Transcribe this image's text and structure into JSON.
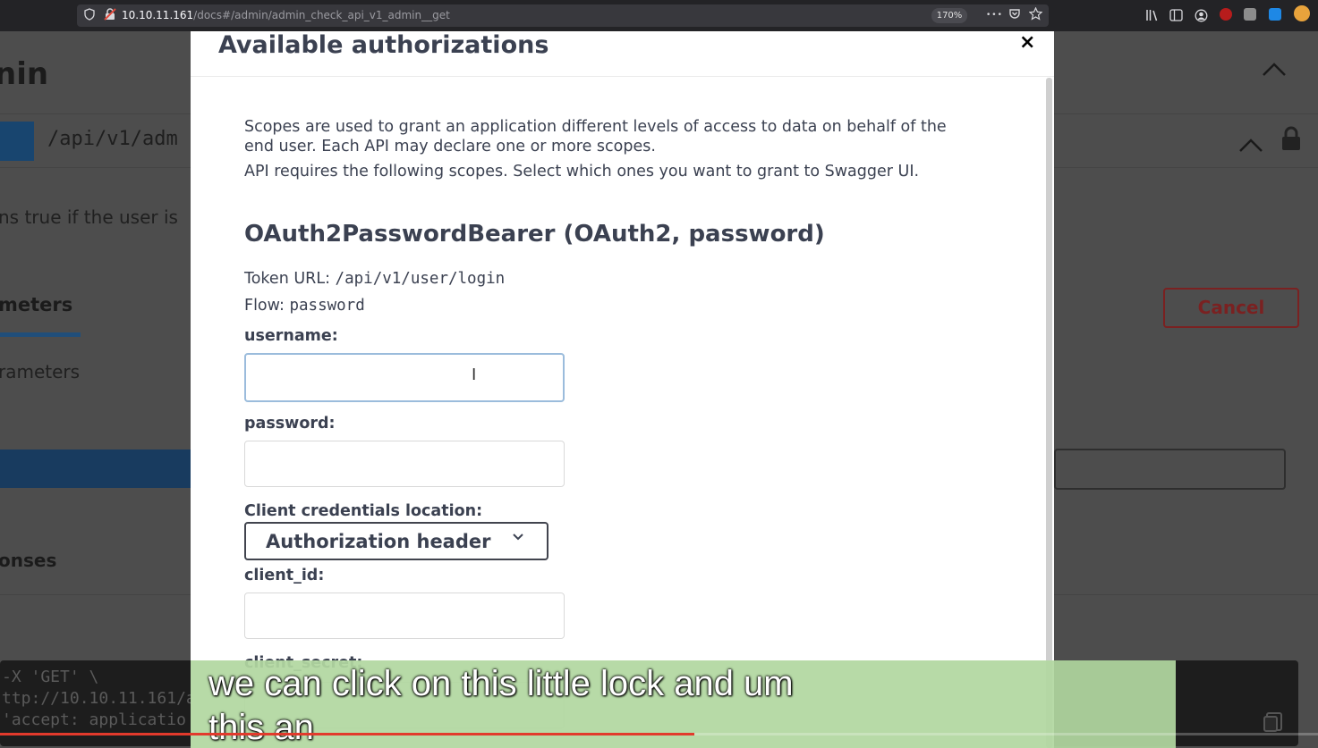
{
  "browser": {
    "url_host": "10.10.11.161",
    "url_path": "/docs#/admin/admin_check_api_v1_admin__get",
    "zoom": "170%",
    "menu_label": "•••"
  },
  "background": {
    "section_title": "nin",
    "endpoint_path": "/api/v1/adm",
    "description": "ns true if the user is",
    "tab_parameters": "meters",
    "no_parameters": "rameters",
    "responses_heading": "onses",
    "cancel_label": "Cancel",
    "curl_lines": [
      "-X 'GET' \\",
      "ttp://10.10.11.161/a",
      "'accept: applicatio"
    ]
  },
  "modal": {
    "title": "Available authorizations",
    "close_glyph": "×",
    "scopes_line1": "Scopes are used to grant an application different levels of access to data on behalf of the",
    "scopes_line2": "end user. Each API may declare one or more scopes.",
    "scopes_line3": "API requires the following scopes. Select which ones you want to grant to Swagger UI.",
    "scheme_title": "OAuth2PasswordBearer (OAuth2, password)",
    "token_url_label": "Token URL:",
    "token_url_value": "/api/v1/user/login",
    "flow_label": "Flow:",
    "flow_value": "password",
    "username_label": "username:",
    "password_label": "password:",
    "client_location_label": "Client credentials location:",
    "client_location_value": "Authorization header",
    "client_id_label": "client_id:",
    "client_secret_label": "client_secret:"
  },
  "subtitle": {
    "line1": "we can click on this little lock and um",
    "line2": "this an"
  },
  "video": {
    "progress": 0.527
  },
  "colors": {
    "accent_blue": "#18456f",
    "cancel_red": "#7a2121",
    "subtitle_green": "#b2d7a0",
    "progress_red": "#e23a2c"
  }
}
